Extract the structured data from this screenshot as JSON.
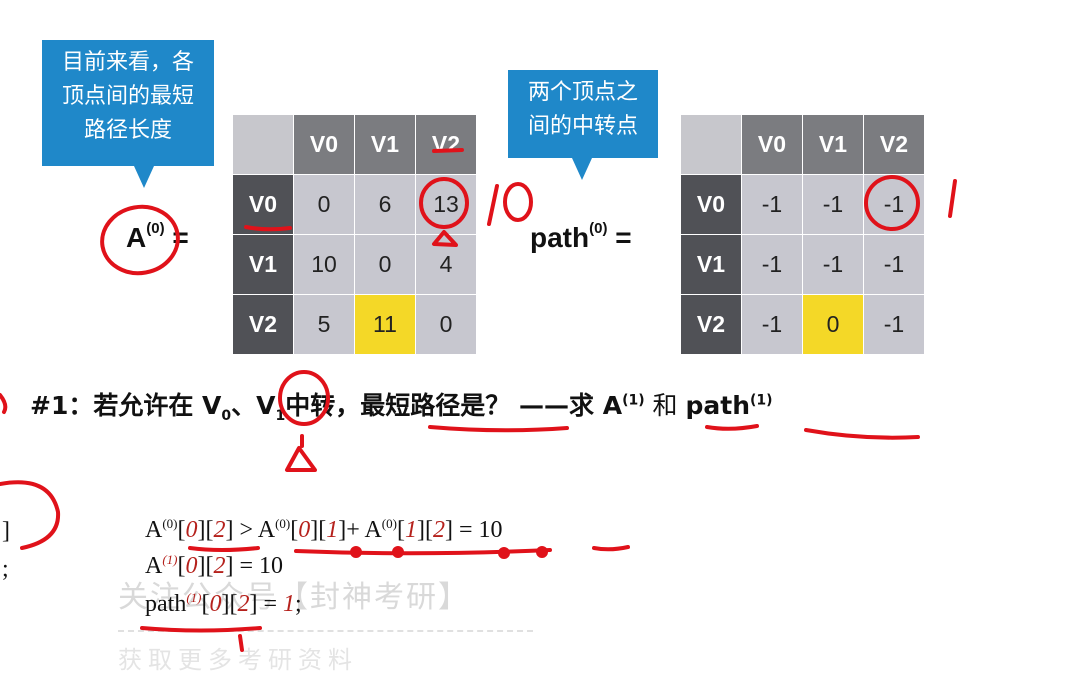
{
  "callout_left": {
    "lines": [
      "目前来看，各",
      "顶点间的最短",
      "路径长度"
    ]
  },
  "callout_right": {
    "lines": [
      "两个顶点之",
      "间的中转点"
    ]
  },
  "matrix_a": {
    "label": "A",
    "superscript": "(0)",
    "equals": "=",
    "col_headers": [
      "V0",
      "V1",
      "V2"
    ],
    "row_headers": [
      "V0",
      "V1",
      "V2"
    ],
    "rows": [
      [
        "0",
        "6",
        "13"
      ],
      [
        "10",
        "0",
        "4"
      ],
      [
        "5",
        "11",
        "0"
      ]
    ]
  },
  "matrix_path": {
    "label": "path",
    "superscript": "(0)",
    "equals": "=",
    "col_headers": [
      "V0",
      "V1",
      "V2"
    ],
    "row_headers": [
      "V0",
      "V1",
      "V2"
    ],
    "rows": [
      [
        "-1",
        "-1",
        "-1"
      ],
      [
        "-1",
        "-1",
        "-1"
      ],
      [
        "-1",
        "0",
        "-1"
      ]
    ]
  },
  "step": {
    "prefix": "#1：若允许在 V",
    "sub0": "0",
    "sep": "、",
    "v1": "V",
    "sub1": "1",
    "middle": "中转，最短路径是？ ——求 ",
    "a": "A",
    "a_sup": "(1)",
    "and": " 和 ",
    "path": "path",
    "path_sup": "(1)"
  },
  "formulas": {
    "line1": {
      "a1": "A",
      "s1": "(0)",
      "i1": "0",
      "i2": "2",
      "op": " > ",
      "a2": "A",
      "s2": "(0)",
      "i3": "0",
      "i4": "1",
      "plus": "+ ",
      "a3": "A",
      "s3": "(0)",
      "i5": "1",
      "i6": "2",
      "eq": " = 10"
    },
    "line2": {
      "a": "A",
      "s": "(1)",
      "i1": "0",
      "i2": "2",
      "eq": " = 10"
    },
    "line3": {
      "p": "path",
      "s": "(1)",
      "i1": "0",
      "i2": "2",
      "eq": " = ",
      "v": "1",
      "end": ";"
    }
  },
  "left_fragments": {
    "f1": "]",
    "f2": ";"
  },
  "watermark": "关注公众号【封神考研】",
  "watermark_bottom": "获取更多考研资料",
  "handwriting": {
    "note_a": "10",
    "note_b": "1"
  },
  "colors": {
    "callout": "#1f88c9",
    "header": "#7b7c80",
    "row_header": "#505156",
    "cell": "#c7c7cf",
    "highlight": "#f4d827",
    "ink": "#e0121a"
  }
}
